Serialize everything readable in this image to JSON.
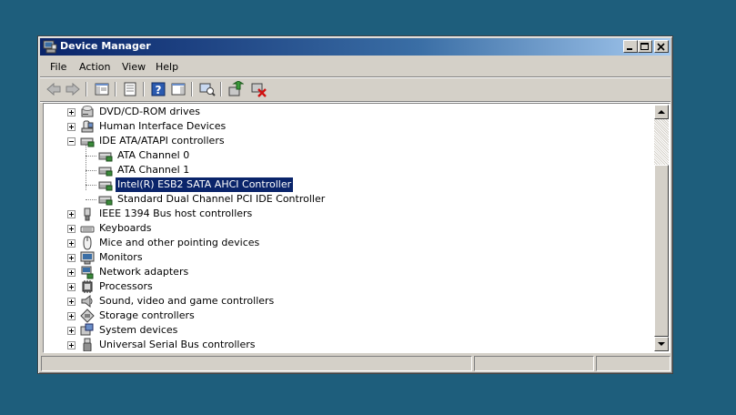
{
  "window": {
    "title": "Device Manager",
    "icon": "device-manager-icon"
  },
  "menu": [
    "File",
    "Action",
    "View",
    "Help"
  ],
  "toolbar": [
    "back-arrow-icon",
    "forward-arrow-icon",
    "show-hide-console-tree-icon",
    "properties-icon",
    "help-icon",
    "show-action-pane-icon",
    "scan-hardware-icon",
    "update-driver-icon",
    "uninstall-device-icon"
  ],
  "tree": [
    {
      "label": "DVD/CD-ROM drives",
      "expander": "plus",
      "icon": "dvd-drive-icon",
      "level": 0
    },
    {
      "label": "Human Interface Devices",
      "expander": "plus",
      "icon": "hid-icon",
      "level": 0
    },
    {
      "label": "IDE ATA/ATAPI controllers",
      "expander": "minus",
      "icon": "ide-controller-icon",
      "level": 0
    },
    {
      "label": "ATA Channel 0",
      "expander": "none",
      "icon": "ide-controller-icon",
      "level": 1
    },
    {
      "label": "ATA Channel 1",
      "expander": "none",
      "icon": "ide-controller-icon",
      "level": 1
    },
    {
      "label": "Intel(R) ESB2 SATA AHCI Controller",
      "expander": "none",
      "icon": "ide-controller-icon",
      "level": 1,
      "selected": true
    },
    {
      "label": "Standard Dual Channel PCI IDE Controller",
      "expander": "none",
      "icon": "ide-controller-icon",
      "level": 1
    },
    {
      "label": "IEEE 1394 Bus host controllers",
      "expander": "plus",
      "icon": "ieee1394-icon",
      "level": 0
    },
    {
      "label": "Keyboards",
      "expander": "plus",
      "icon": "keyboard-icon",
      "level": 0
    },
    {
      "label": "Mice and other pointing devices",
      "expander": "plus",
      "icon": "mouse-icon",
      "level": 0
    },
    {
      "label": "Monitors",
      "expander": "plus",
      "icon": "monitor-icon",
      "level": 0
    },
    {
      "label": "Network adapters",
      "expander": "plus",
      "icon": "network-adapter-icon",
      "level": 0
    },
    {
      "label": "Processors",
      "expander": "plus",
      "icon": "processor-icon",
      "level": 0
    },
    {
      "label": "Sound, video and game controllers",
      "expander": "plus",
      "icon": "sound-icon",
      "level": 0
    },
    {
      "label": "Storage controllers",
      "expander": "plus",
      "icon": "storage-controller-icon",
      "level": 0
    },
    {
      "label": "System devices",
      "expander": "plus",
      "icon": "system-devices-icon",
      "level": 0
    },
    {
      "label": "Universal Serial Bus controllers",
      "expander": "plus",
      "icon": "usb-icon",
      "level": 0
    }
  ],
  "colors": {
    "desktop": "#1e5e7c",
    "selection": "#0a246a",
    "chrome": "#d4d0c8"
  }
}
